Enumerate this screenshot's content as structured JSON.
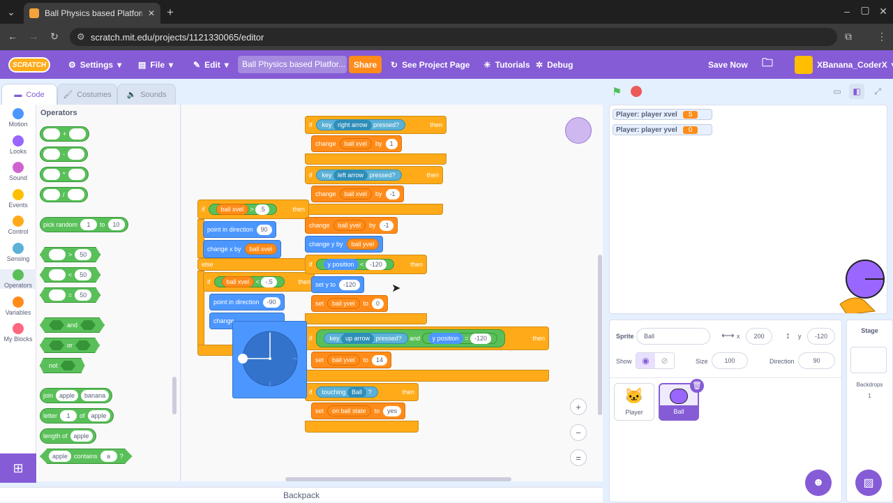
{
  "browser": {
    "tab_title": "Ball Physics based Platformer",
    "url": "scratch.mit.edu/projects/1121330065/editor"
  },
  "menubar": {
    "logo": "SCRATCH",
    "settings": "Settings",
    "file": "File",
    "edit": "Edit",
    "project_title": "Ball Physics based Platfor...",
    "share": "Share",
    "see_project_page": "See Project Page",
    "tutorials": "Tutorials",
    "debug": "Debug",
    "save_now": "Save Now",
    "username": "XBanana_CoderX"
  },
  "editor_tabs": {
    "code": "Code",
    "costumes": "Costumes",
    "sounds": "Sounds"
  },
  "categories": [
    {
      "label": "Motion",
      "color": "#4c97ff"
    },
    {
      "label": "Looks",
      "color": "#9966ff"
    },
    {
      "label": "Sound",
      "color": "#cf63cf"
    },
    {
      "label": "Events",
      "color": "#ffbf00"
    },
    {
      "label": "Control",
      "color": "#ffab19"
    },
    {
      "label": "Sensing",
      "color": "#5cb1d6"
    },
    {
      "label": "Operators",
      "color": "#59c059"
    },
    {
      "label": "Variables",
      "color": "#ff8c1a"
    },
    {
      "label": "My Blocks",
      "color": "#ff6680"
    }
  ],
  "palette": {
    "heading": "Operators",
    "add": "+",
    "sub": "-",
    "mul": "*",
    "div": "/",
    "pick_random": "pick random",
    "rand_from": "1",
    "rand_to_word": "to",
    "rand_to": "10",
    "gt": ">",
    "lt": "<",
    "eq": "=",
    "fifty": "50",
    "and": "and",
    "or": "or",
    "not": "not",
    "join": "join",
    "apple": "apple",
    "banana": "banana",
    "letter": "letter",
    "one": "1",
    "of": "of",
    "length_of": "length of",
    "contains": "contains",
    "a": "a",
    "q": "?"
  },
  "script": {
    "if": "if",
    "then": "then",
    "else": "else",
    "key": "key",
    "right_arrow": "right arrow",
    "left_arrow": "left arrow",
    "up_arrow": "up arrow",
    "pressed": "pressed?",
    "change": "change",
    "ball_xvel": "ball xvel",
    "ball_yvel": "ball yvel",
    "by": "by",
    "one": "1",
    "neg_one": "-1",
    "point_half": ".5",
    "neg_half": "-.5",
    "point_in_direction": "point in direction",
    "dir_90": "90",
    "dir_neg90": "-90",
    "change_x_by": "change x by",
    "change_y_by": "change y by",
    "change_word": "change",
    "y_position": "y position",
    "neg120": "-120",
    "set_y_to": "set y to",
    "set": "set",
    "to": "to",
    "zero": "0",
    "fourteen": "14",
    "and": "and",
    "touching": "touching",
    "ball": "Ball",
    "q": "?",
    "on_ball_state": "on ball state",
    "yes": "yes",
    "gt": ">",
    "lt": "<",
    "eq": "="
  },
  "zoom": {
    "in": "+",
    "out": "−",
    "reset": "="
  },
  "backpack": "Backpack",
  "monitors": [
    {
      "label": "Player: player xvel",
      "value": "5"
    },
    {
      "label": "Player: player yvel",
      "value": "0"
    }
  ],
  "sprite_info": {
    "sprite_label": "Sprite",
    "sprite_name": "Ball",
    "x_label": "x",
    "x": "200",
    "y_label": "y",
    "y": "-120",
    "show_label": "Show",
    "size_label": "Size",
    "size": "100",
    "direction_label": "Direction",
    "direction": "90"
  },
  "sprites": [
    {
      "name": "Player"
    },
    {
      "name": "Ball"
    }
  ],
  "stage_panel": {
    "title": "Stage",
    "backdrops_label": "Backdrops",
    "backdrops_count": "1"
  }
}
